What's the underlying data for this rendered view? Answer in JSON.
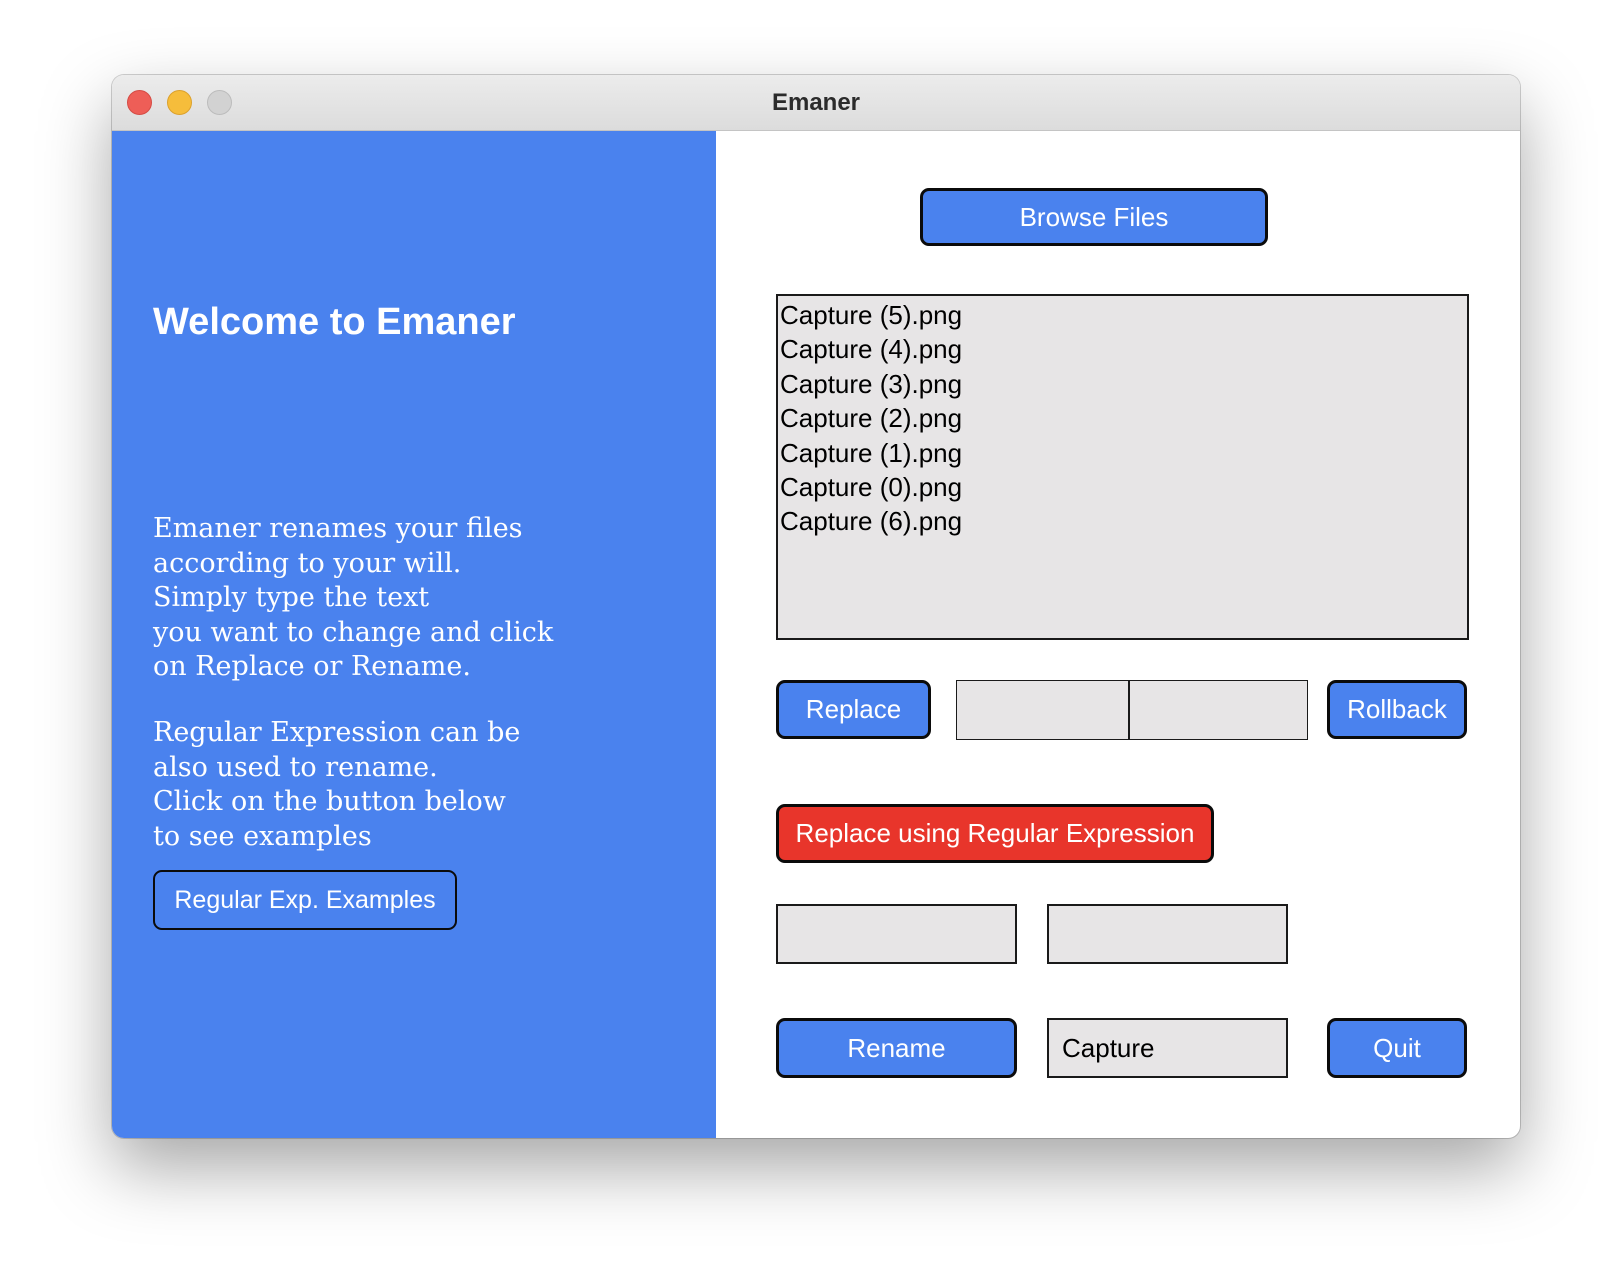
{
  "window": {
    "title": "Emaner"
  },
  "sidebar": {
    "heading": "Welcome to Emaner",
    "description_1": "Emaner renames your files\naccording to your will.\nSimply type the text\nyou want to change and click\non Replace or Rename.",
    "description_2": "Regular Expression can be\nalso used to rename.\nClick on the button below\nto see examples",
    "examples_button": "Regular Exp. Examples"
  },
  "main": {
    "browse_button": "Browse Files",
    "files": [
      "Capture (5).png",
      "Capture (4).png",
      "Capture (3).png",
      "Capture (2).png",
      "Capture (1).png",
      "Capture (0).png",
      "Capture (6).png"
    ],
    "replace_button": "Replace",
    "replace_find_value": "",
    "replace_with_value": "",
    "rollback_button": "Rollback",
    "regex_button": "Replace using Regular Expression",
    "regex_pattern_value": "",
    "regex_replacement_value": "",
    "rename_button": "Rename",
    "rename_value": "Capture",
    "quit_button": "Quit"
  },
  "colors": {
    "primary_blue": "#4a82ee",
    "danger_red": "#e8352b",
    "field_gray": "#e7e5e6",
    "border_dark": "#0b0b0b"
  },
  "icons": {
    "close": "traffic-light-close",
    "minimize": "traffic-light-minimize",
    "zoom": "traffic-light-zoom"
  }
}
